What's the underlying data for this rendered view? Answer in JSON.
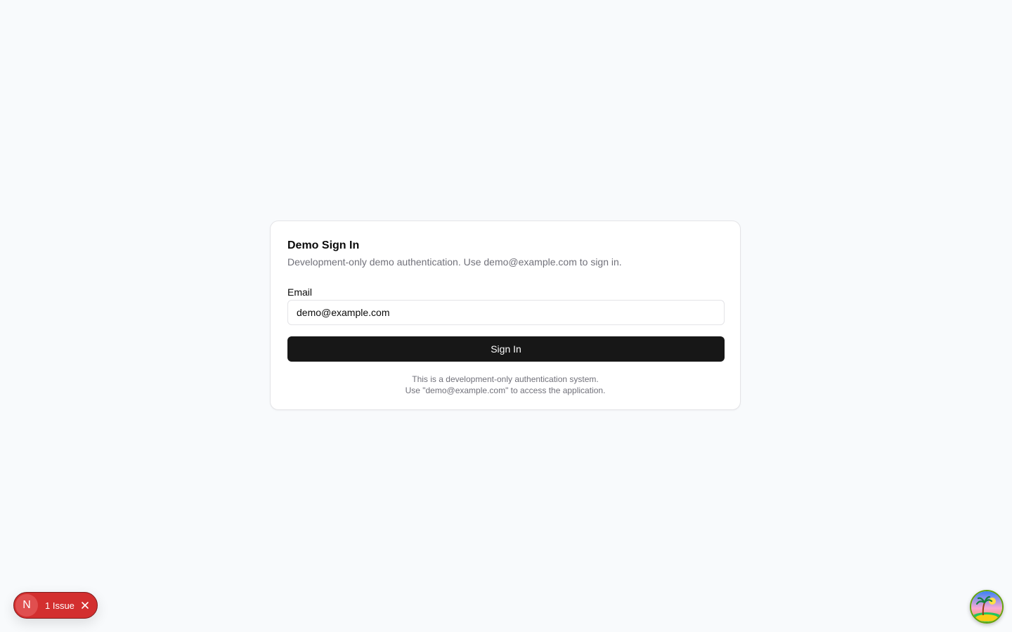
{
  "signin": {
    "title": "Demo Sign In",
    "description": "Development-only demo authentication. Use demo@example.com to sign in.",
    "email_label": "Email",
    "email_value": "demo@example.com",
    "submit_label": "Sign In",
    "help_line1": "This is a development-only authentication system.",
    "help_line2": "Use \"demo@example.com\" to access the application."
  },
  "devtools": {
    "logo_letter": "N",
    "issue_label": "1 Issue",
    "close_icon": "close-icon",
    "badge_color": "#d32f2f"
  },
  "corner_widget": {
    "icon": "island-palm-tree-icon"
  },
  "colors": {
    "background": "#f8fafc",
    "primary_button": "#171717",
    "muted_text": "#71717a"
  }
}
